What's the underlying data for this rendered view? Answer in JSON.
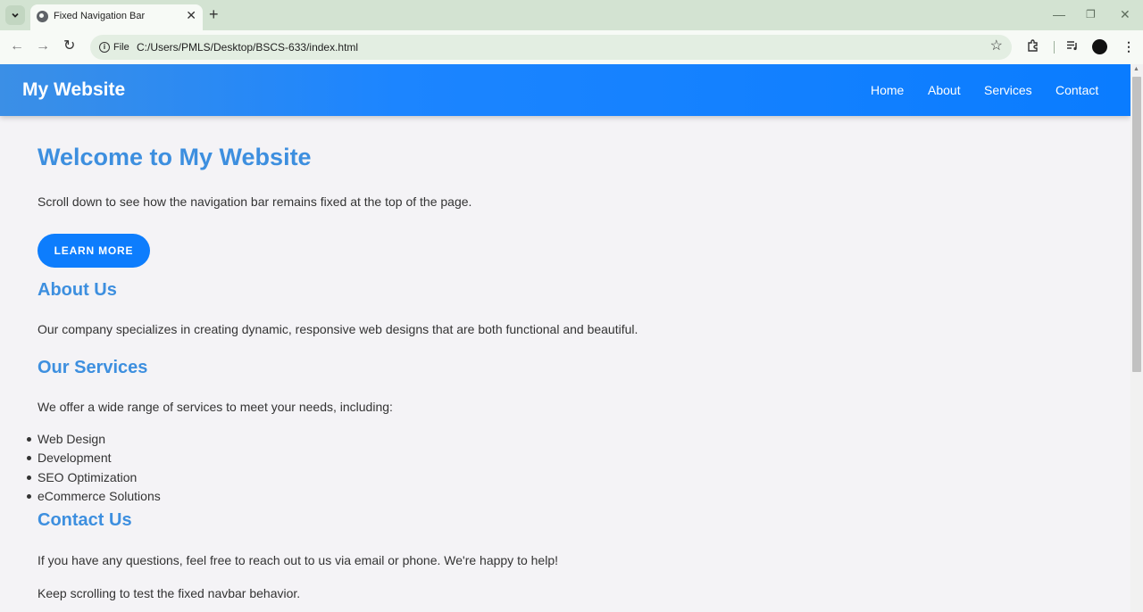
{
  "browser": {
    "tab_title": "Fixed Navigation Bar",
    "new_tab_icon": "+",
    "info_chip_label": "File",
    "url": "C:/Users/PMLS/Desktop/BSCS-633/index.html"
  },
  "site": {
    "brand": "My Website",
    "nav": [
      "Home",
      "About",
      "Services",
      "Contact"
    ],
    "hero_title": "Welcome to My Website",
    "hero_text": "Scroll down to see how the navigation bar remains fixed at the top of the page.",
    "cta_label": "LEARN MORE",
    "about_title": "About Us",
    "about_text": "Our company specializes in creating dynamic, responsive web designs that are both functional and beautiful.",
    "services_title": "Our Services",
    "services_text": "We offer a wide range of services to meet your needs, including:",
    "services_list": [
      "Web Design",
      "Development",
      "SEO Optimization",
      "eCommerce Solutions"
    ],
    "contact_title": "Contact Us",
    "contact_text": "If you have any questions, feel free to reach out to us via email or phone. We're happy to help!",
    "footer_text": "Keep scrolling to test the fixed navbar behavior."
  },
  "colors": {
    "nav_bg": "#0a7cff",
    "heading": "#3d8fdf",
    "button": "#0d7dfd",
    "page_bg": "#f4f3f6"
  }
}
